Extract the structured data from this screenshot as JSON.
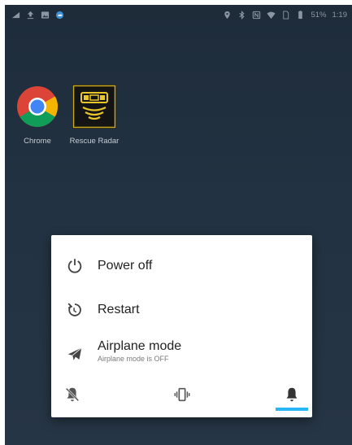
{
  "status_bar": {
    "battery": "51%",
    "time": "1:19",
    "left_icons": [
      "signal-icon",
      "upload-icon",
      "image-icon",
      "weather-icon"
    ],
    "right_icons": [
      "location-icon",
      "bluetooth-icon",
      "nfc-icon",
      "wifi-icon",
      "sim-icon",
      "battery-icon"
    ]
  },
  "home": {
    "apps": [
      {
        "label": "Chrome",
        "icon": "chrome-icon"
      },
      {
        "label": "Rescue Radar",
        "icon": "rescue-radar-icon"
      }
    ]
  },
  "power_menu": {
    "items": [
      {
        "label": "Power off",
        "icon": "power-icon"
      },
      {
        "label": "Restart",
        "icon": "restart-icon"
      },
      {
        "label": "Airplane mode",
        "sublabel": "Airplane mode is OFF",
        "icon": "airplane-icon"
      }
    ],
    "sound_modes": [
      "mute-bell-icon",
      "vibrate-icon",
      "bell-icon"
    ],
    "selected_sound_mode": "bell-icon",
    "accent_color": "#29b6f6"
  }
}
